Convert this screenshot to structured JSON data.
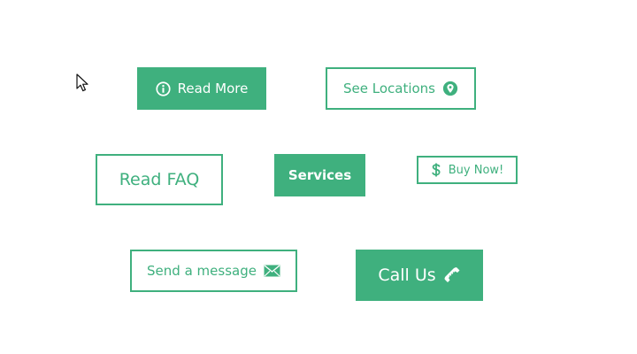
{
  "colors": {
    "accent": "#3fb07e",
    "background": "#ffffff",
    "on_accent": "#ffffff"
  },
  "buttons": {
    "read_more": {
      "label": "Read More",
      "style": "filled",
      "icon": "info-icon"
    },
    "see_locations": {
      "label": "See Locations",
      "style": "outline",
      "icon": "map-pin-icon"
    },
    "read_faq": {
      "label": "Read FAQ",
      "style": "outline",
      "icon": ""
    },
    "services": {
      "label": "Services",
      "style": "filled",
      "icon": ""
    },
    "buy_now": {
      "label": "Buy Now!",
      "style": "outline",
      "icon": "dollar-icon"
    },
    "send_message": {
      "label": "Send a message",
      "style": "outline",
      "icon": "envelope-icon"
    },
    "call_us": {
      "label": "Call Us",
      "style": "filled",
      "icon": "phone-icon"
    }
  },
  "cursor": {
    "icon": "mouse-pointer-icon"
  }
}
